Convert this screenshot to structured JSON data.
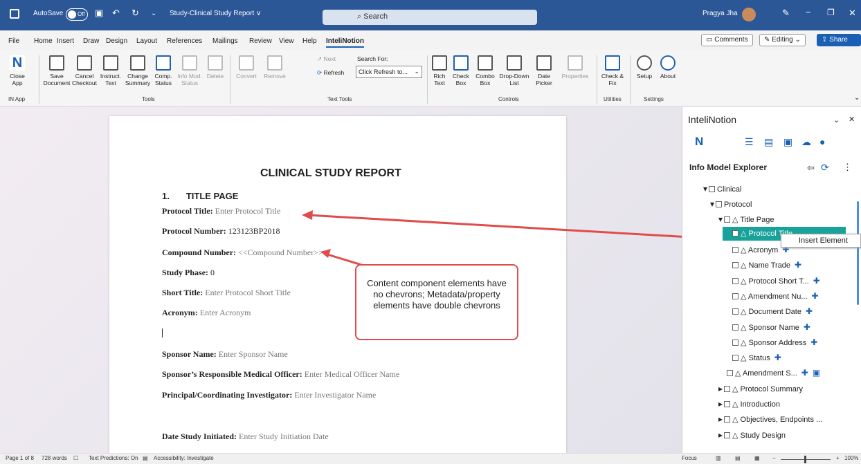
{
  "titlebar": {
    "autosave": "AutoSave",
    "toggle": "Off",
    "doc_title": "Study-Clinical Study Report ∨",
    "search": "Search",
    "user": "Pragya Jha"
  },
  "menu": {
    "items": [
      "File",
      "Home",
      "Insert",
      "Draw",
      "Design",
      "Layout",
      "References",
      "Mailings",
      "Review",
      "View",
      "Help",
      "InteliNotion"
    ],
    "comments": "Comments",
    "editing": "Editing",
    "share": "Share"
  },
  "ribbon": {
    "close_app": "Close App",
    "save_document": "Save Document",
    "cancel_checkout": "Cancel Checkout",
    "instruct_text": "Instruct. Text",
    "change_summary": "Change Summary",
    "comp_status": "Comp. Status",
    "info_mod_status": "Info Mod. Status",
    "delete": "Delete",
    "convert": "Convert",
    "remove": "Remove",
    "next": "Next",
    "refresh": "Refresh",
    "search_for": "Search For:",
    "search_value": "Click Refresh to...",
    "rich_text": "Rich Text",
    "check_box": "Check Box",
    "combo_box": "Combo Box",
    "dropdown_list": "Drop-Down List",
    "date_picker": "Date Picker",
    "properties": "Properties",
    "check_fix": "Check & Fix",
    "setup": "Setup",
    "about": "About",
    "groups": {
      "in_app": "IN App",
      "tools": "Tools",
      "text_tools": "Text Tools",
      "controls": "Controls",
      "utilities": "Utilities",
      "settings": "Settings"
    }
  },
  "document": {
    "heading": "CLINICAL STUDY REPORT",
    "section_num": "1.",
    "section_title": "TITLE PAGE",
    "fields": [
      {
        "label": "Protocol Title:",
        "value": "Enter Protocol Title"
      },
      {
        "label": "Protocol Number:",
        "value": "123123BP2018"
      },
      {
        "label": "Compound Number:",
        "value": "<<Compound Number>>"
      },
      {
        "label": "Study Phase:",
        "value": "0"
      },
      {
        "label": "Short Title:",
        "value": "Enter Protocol Short Title"
      },
      {
        "label": "Acronym:",
        "value": "Enter Acronym"
      },
      {
        "label": "Sponsor Name:",
        "value": "Enter Sponsor Name"
      },
      {
        "label": "Sponsor’s Responsible Medical Officer:",
        "value": "Enter Medical Officer Name"
      },
      {
        "label": "Principal/Coordinating Investigator:",
        "value": "Enter Investigator Name"
      },
      {
        "label": "Date Study Initiated:",
        "value": "Enter Study Initiation Date"
      }
    ]
  },
  "callout": {
    "text": "Content component elements have no chevrons; Metadata/property elements have double chevrons"
  },
  "panel": {
    "title": "InteliNotion",
    "explorer_title": "Info Model Explorer",
    "tree": [
      "Clinical",
      "Protocol",
      "Title Page",
      "Protocol Title",
      "Acronym",
      "Name Trade",
      "Protocol Short T...",
      "Amendment Nu...",
      "Document Date",
      "Sponsor Name",
      "Sponsor Address",
      "Status",
      "Amendment S...",
      "Protocol Summary",
      "Introduction",
      "Objectives, Endpoints ...",
      "Study Design"
    ],
    "context_menu": "Insert Element"
  },
  "status": {
    "page": "Page 1 of 8",
    "words": "728 words",
    "predictions": "Text Predictions: On",
    "accessibility": "Accessibility: Investigate",
    "focus": "Focus",
    "zoom": "100%"
  },
  "colors": {
    "titlebar": "#2b5797",
    "accent": "#1a5fb4",
    "callout_border": "#e14b4b",
    "selection": "#17a39a"
  }
}
